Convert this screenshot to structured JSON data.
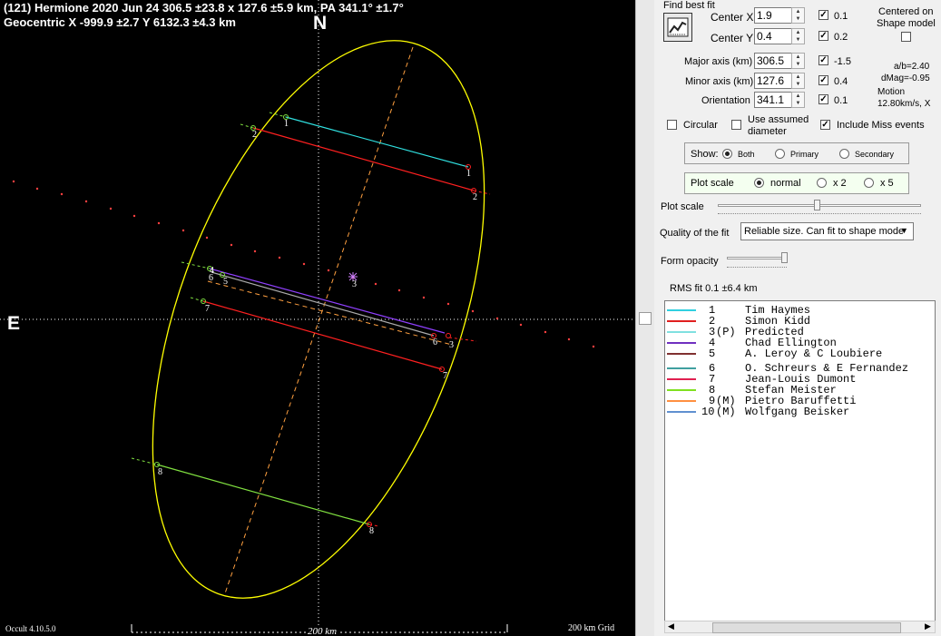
{
  "plot": {
    "title_line1": "(121) Hermione  2020 Jun 24   306.5 ±23.8 x 127.6 ±5.9 km, PA 341.1° ±1.7°",
    "title_line2": "Geocentric  X  -999.9 ±2.7  Y 6132.3 ±4.3 km",
    "north": "N",
    "east": "E",
    "version": "Occult 4.10.5.0",
    "scale_label": "200 km",
    "grid_label": "200 km Grid",
    "chord_labels": [
      "1",
      "2",
      "3",
      "4",
      "5",
      "6",
      "7",
      "8"
    ],
    "colors": {
      "ellipse": "#ffff00",
      "axis": "#ffa040",
      "chord1": "#30e0e0",
      "chord2": "#ff2020",
      "chord4": "#9040ff",
      "chord5": "#999999",
      "chord6": "#ff2020",
      "chord7": "#ff2020",
      "chord8": "#80e040",
      "predicted": "#ffa040"
    }
  },
  "panel": {
    "find_best_fit": "Find best fit",
    "center_x_label": "Center X",
    "center_x_value": "1.9",
    "center_x_step": "0.1",
    "center_y_label": "Center Y",
    "center_y_value": "0.4",
    "center_y_step": "0.2",
    "centered_on_line1": "Centered on",
    "centered_on_line2": "Shape model",
    "major_label": "Major axis (km)",
    "major_value": "306.5",
    "major_step": "-1.5",
    "minor_label": "Minor axis (km)",
    "minor_value": "127.6",
    "minor_step": "0.4",
    "orient_label": "Orientation",
    "orient_value": "341.1",
    "orient_step": "0.1",
    "ab_ratio": "a/b=2.40",
    "dmag": "dMag=-0.95",
    "motion_label": "Motion",
    "motion_value": "12.80km/s, X",
    "circular": "Circular",
    "use_assumed_line1": "Use assumed",
    "use_assumed_line2": "diameter",
    "include_miss": "Include Miss events",
    "show_label": "Show:",
    "show_both": "Both",
    "show_primary": "Primary",
    "show_secondary": "Secondary",
    "plot_scale_group": "Plot scale",
    "scale_normal": "normal",
    "scale_x2": "x 2",
    "scale_x5": "x 5",
    "plot_scale_slider": "Plot scale",
    "quality_label": "Quality of the fit",
    "quality_value": "Reliable size. Can fit to shape mode",
    "form_opacity": "Form opacity",
    "rms_fit": "RMS fit 0.1 ±6.4 km"
  },
  "legend": [
    {
      "num": "1",
      "tag": "   ",
      "name": "Tim Haymes",
      "color": "#30d0e0"
    },
    {
      "num": "2",
      "tag": "   ",
      "name": "Simon Kidd",
      "color": "#e02020"
    },
    {
      "num": "3",
      "tag": "(P)",
      "name": "Predicted",
      "color": "#80e0e0"
    },
    {
      "num": "4",
      "tag": "   ",
      "name": "Chad Ellington",
      "color": "#7030c0"
    },
    {
      "num": "5",
      "tag": "   ",
      "name": "A. Leroy & C Loubiere",
      "color": "#803030"
    },
    {
      "num": "6",
      "tag": "   ",
      "name": "O. Schreurs & E Fernandez",
      "color": "#40a0a0"
    },
    {
      "num": "7",
      "tag": "   ",
      "name": "Jean-Louis Dumont",
      "color": "#e02050"
    },
    {
      "num": "8",
      "tag": "   ",
      "name": "Stefan Meister",
      "color": "#80e020"
    },
    {
      "num": "9",
      "tag": "(M)",
      "name": "Pietro Baruffetti",
      "color": "#ff9040"
    },
    {
      "num": "10",
      "tag": "(M)",
      "name": "Wolfgang Beisker",
      "color": "#6090d0"
    }
  ]
}
